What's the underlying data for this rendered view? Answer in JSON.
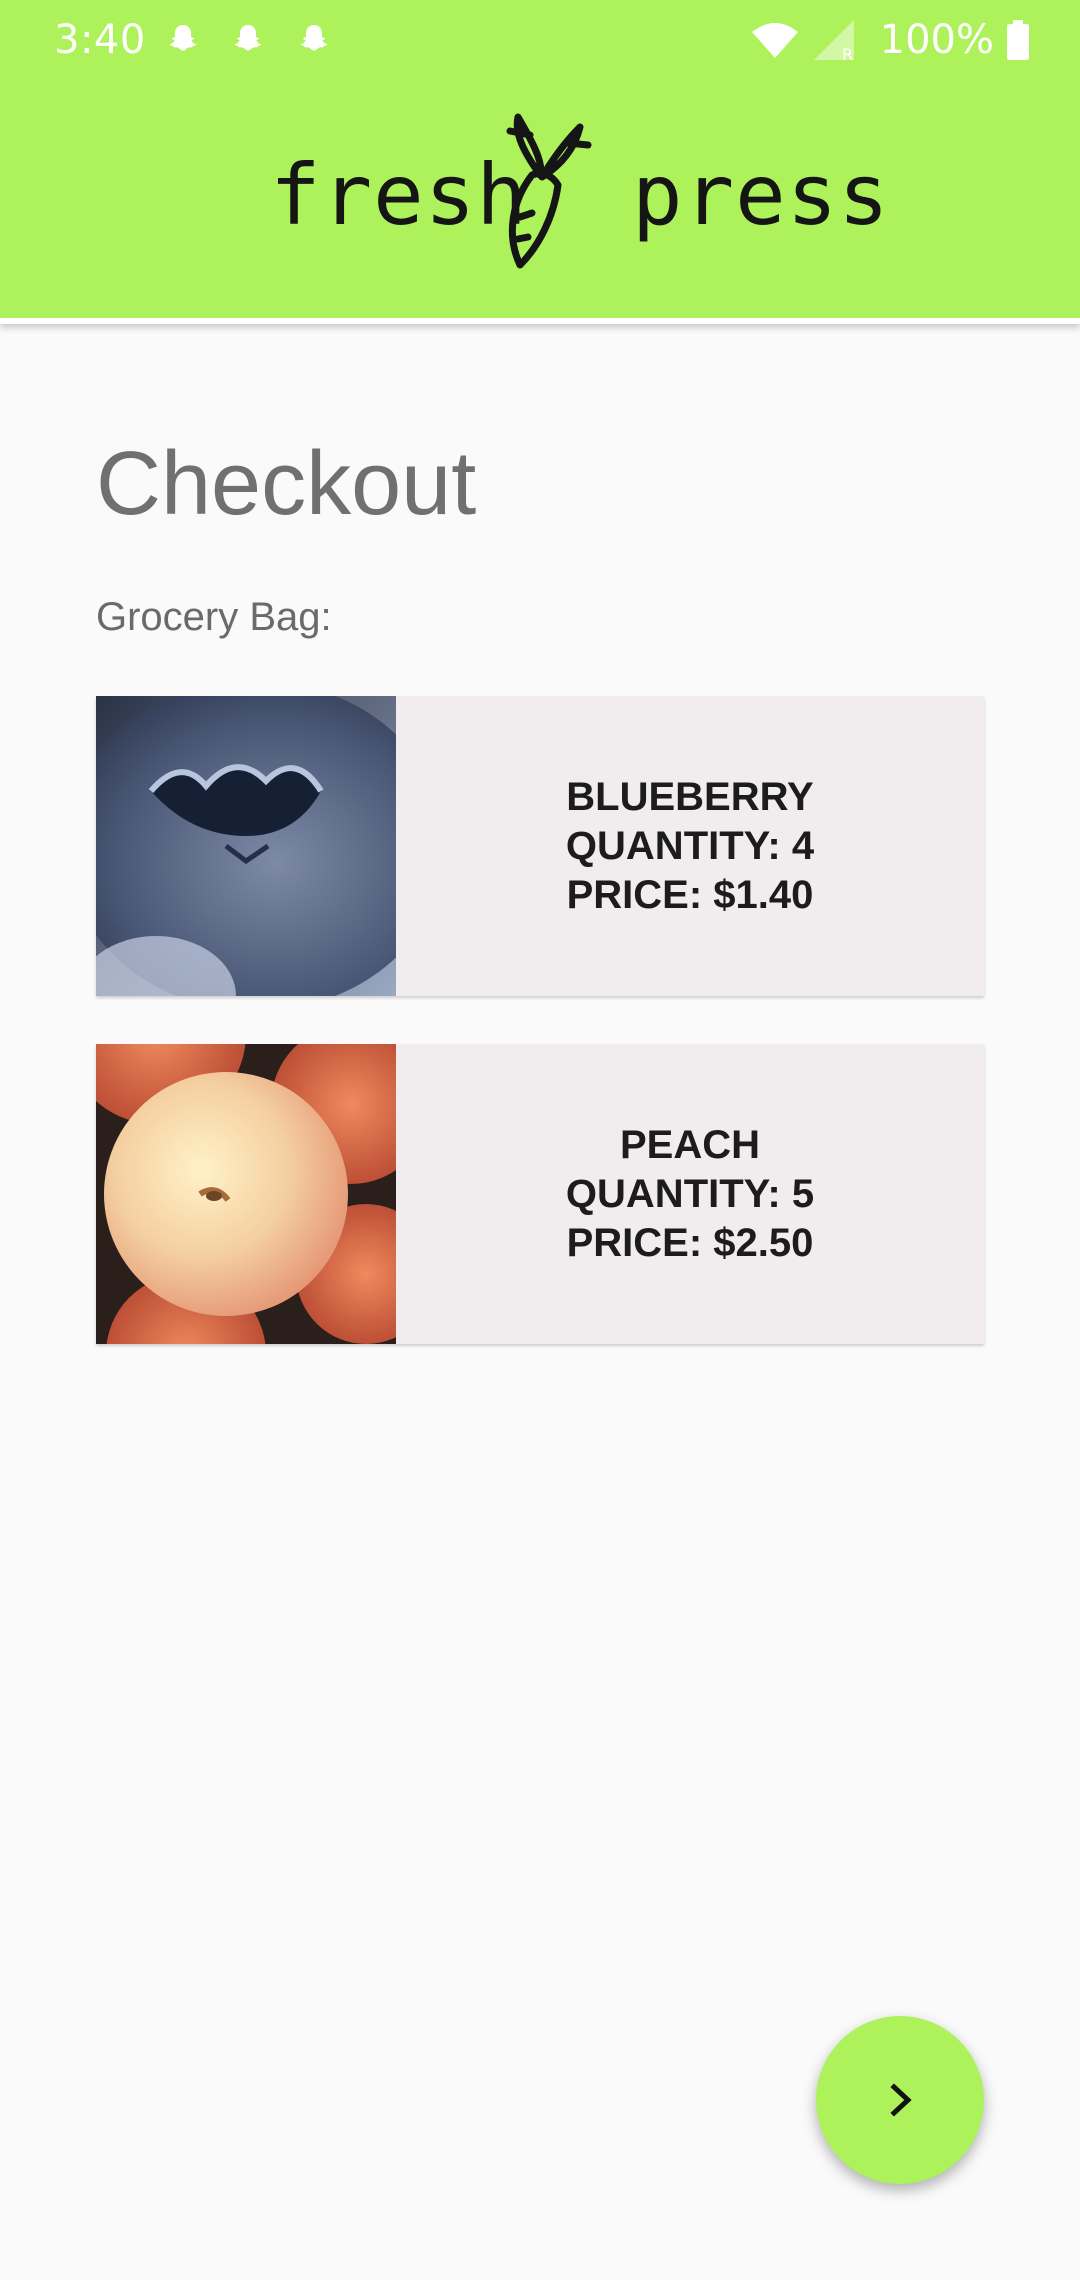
{
  "status_bar": {
    "time": "3:40",
    "battery": "100%",
    "notification_icons": [
      "snapchat-ghost-icon",
      "snapchat-ghost-icon",
      "snapchat-ghost-icon"
    ]
  },
  "header": {
    "logo_left": "fresh",
    "logo_right": "press",
    "color": "#adf25b"
  },
  "main": {
    "title": "Checkout",
    "subtitle": "Grocery Bag:",
    "items": [
      {
        "name": "BLUEBERRY",
        "quantity": "QUANTITY: 4",
        "price": "PRICE: $1.40",
        "image": "blueberry-photo"
      },
      {
        "name": "PEACH",
        "quantity": "QUANTITY: 5",
        "price": "PRICE: $2.50",
        "image": "peach-photo"
      }
    ]
  },
  "fab": {
    "icon": "chevron-right-icon"
  }
}
